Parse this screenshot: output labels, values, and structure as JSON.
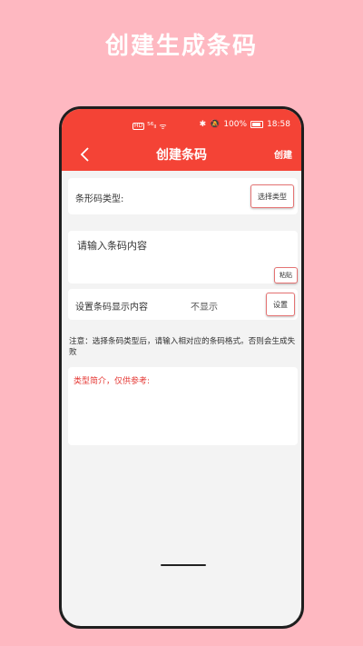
{
  "promo": {
    "title": "创建生成条码"
  },
  "status_bar": {
    "left_badge": "HD",
    "left_signal": "⁵⁶ₗₗ",
    "left_wifi": "ᯤ",
    "bluetooth": "✱",
    "mute": "🔕",
    "battery_text": "100%",
    "time": "18:58"
  },
  "header": {
    "title": "创建条码",
    "action_label": "创建",
    "background": "#F44336"
  },
  "type_row": {
    "label": "条形码类型:",
    "button_label": "选择类型"
  },
  "content_input": {
    "placeholder": "请输入条码内容",
    "value": "",
    "paste_label": "粘贴"
  },
  "display_row": {
    "label": "设置条码显示内容",
    "value": "不显示",
    "button_label": "设置"
  },
  "note": "注意：选择条码类型后，请输入相对应的条码格式。否则会生成失败",
  "intro": {
    "label": "类型简介，仅供参考:"
  },
  "colors": {
    "page_background": "#FEB8C1",
    "accent": "#F44336",
    "button_border": "#E57373",
    "intro_text": "#E53935"
  }
}
